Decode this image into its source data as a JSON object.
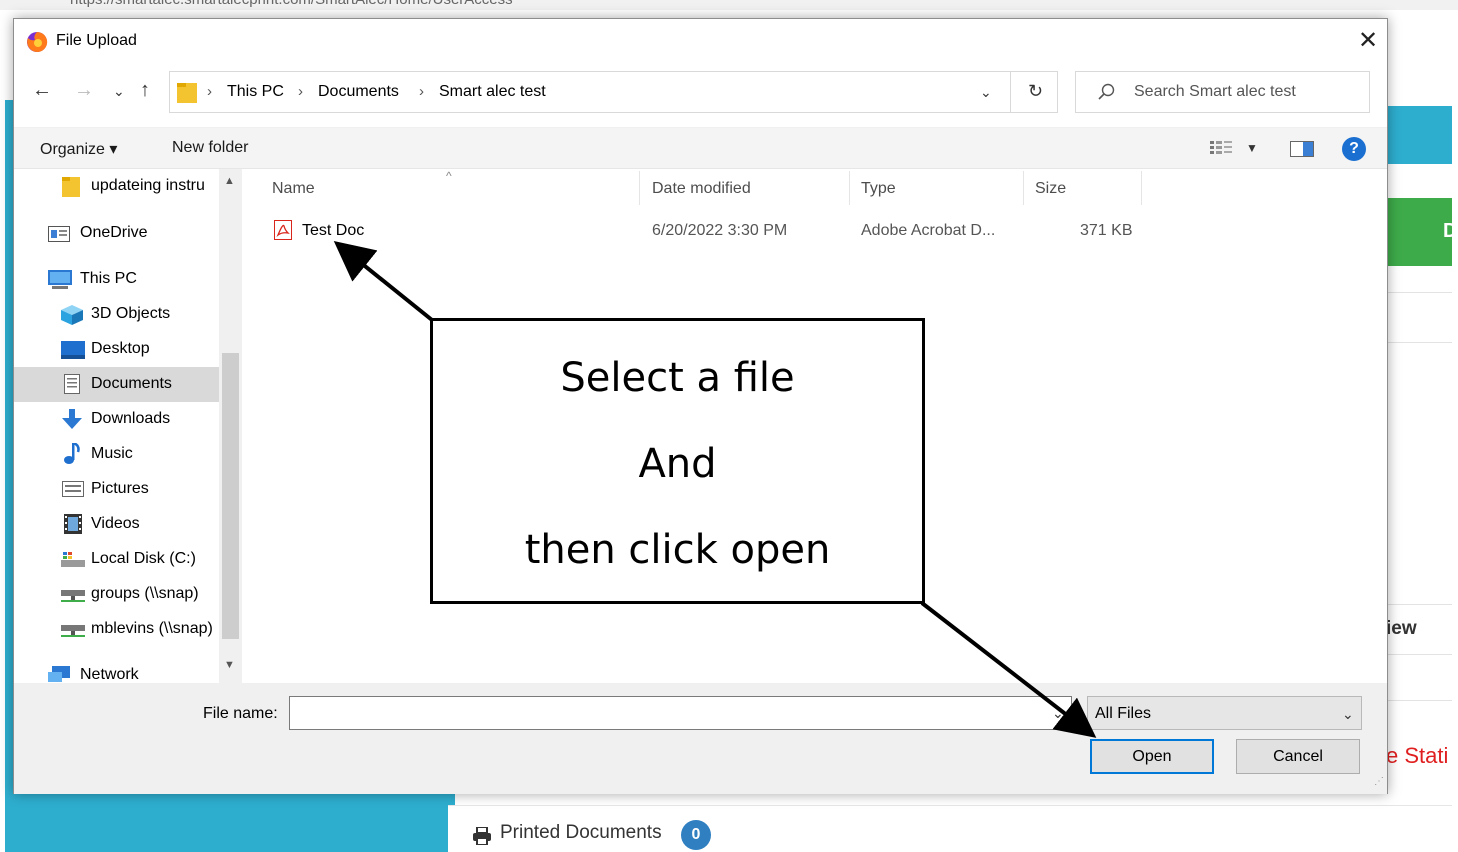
{
  "browser": {
    "url_fragment": "https://smartalec.smartalecprint.com/SmartAlec/Home/UserAccess"
  },
  "background_page": {
    "right_green_letter": "D",
    "right_view_text": "iew",
    "right_static_text": "e Stati",
    "printed_documents_label": "Printed Documents",
    "printed_documents_count": "0"
  },
  "dialog": {
    "title": "File Upload",
    "close_glyph": "✕",
    "nav": {
      "back": "←",
      "forward": "→",
      "recent": "⌄",
      "up": "↑"
    },
    "breadcrumbs": [
      "This PC",
      "Documents",
      "Smart alec test"
    ],
    "breadcrumb_separator": "›",
    "refresh_glyph": "↻",
    "search_placeholder": "Search Smart alec test",
    "toolbar": {
      "organize": "Organize ▾",
      "new_folder": "New folder",
      "help": "?"
    },
    "nav_pane": [
      {
        "label": "updateing instru",
        "icon": "folder-icon"
      },
      {
        "label": "OneDrive",
        "icon": "onedrive-icon"
      },
      {
        "label": "This PC",
        "icon": "computer-icon"
      },
      {
        "label": "3D Objects",
        "icon": "cube-icon"
      },
      {
        "label": "Desktop",
        "icon": "desktop-icon"
      },
      {
        "label": "Documents",
        "icon": "documents-icon",
        "selected": true
      },
      {
        "label": "Downloads",
        "icon": "download-icon"
      },
      {
        "label": "Music",
        "icon": "music-icon"
      },
      {
        "label": "Pictures",
        "icon": "pictures-icon"
      },
      {
        "label": "Videos",
        "icon": "videos-icon"
      },
      {
        "label": "Local Disk (C:)",
        "icon": "disk-icon"
      },
      {
        "label": "groups (\\\\snap)",
        "icon": "network-drive-icon"
      },
      {
        "label": "mblevins (\\\\snap)",
        "icon": "network-drive-icon"
      },
      {
        "label": "Network",
        "icon": "network-icon"
      }
    ],
    "columns": {
      "name": "Name",
      "date": "Date modified",
      "type": "Type",
      "size": "Size"
    },
    "files": [
      {
        "name": "Test Doc",
        "date": "6/20/2022 3:30 PM",
        "type": "Adobe Acrobat D...",
        "size": "371 KB"
      }
    ],
    "file_name_label": "File name:",
    "file_name_value": "",
    "file_type": "All Files",
    "open_label": "Open",
    "cancel_label": "Cancel"
  },
  "callout": {
    "line1": "Select a file",
    "line2": "And",
    "line3": "then click open"
  },
  "colors": {
    "bg_blue": "#2eaecf",
    "bg_green": "#3eab4a",
    "accent": "#0078d7",
    "static_red": "#e02020",
    "badge_blue": "#2f7fc1"
  }
}
